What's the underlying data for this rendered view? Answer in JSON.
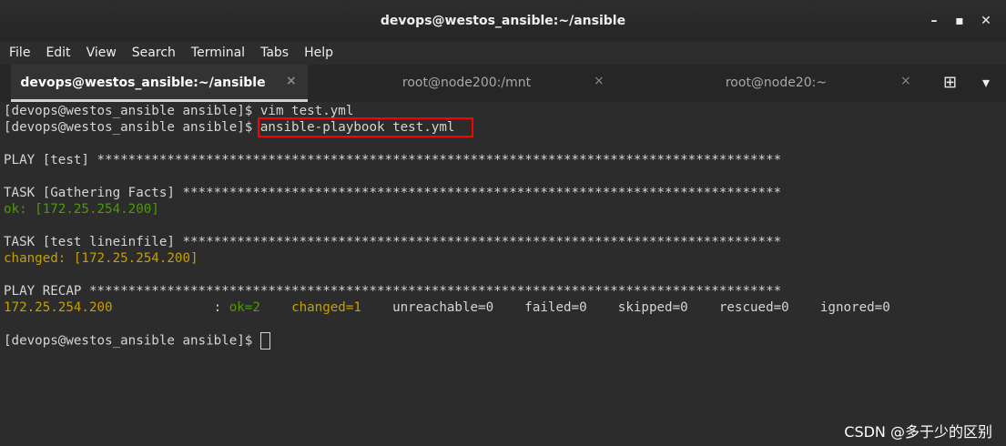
{
  "window": {
    "title": "devops@westos_ansible:~/ansible",
    "min": "–",
    "max": "▪",
    "close": "✕"
  },
  "menu": [
    "File",
    "Edit",
    "View",
    "Search",
    "Terminal",
    "Tabs",
    "Help"
  ],
  "tabs": [
    {
      "label": "devops@westos_ansible:~/ansible",
      "close": "×"
    },
    {
      "label": "root@node200:/mnt",
      "close": "×"
    },
    {
      "label": "root@node20:~",
      "close": "×"
    }
  ],
  "tabbar_icons": {
    "new_tab": "⊞",
    "dropdown": "▾"
  },
  "terminal": {
    "prompt": "[devops@westos_ansible ansible]$ ",
    "cmd1": "vim test.yml",
    "cmd2": "ansible-playbook test.yml",
    "play": "PLAY [test] ****************************************************************************************",
    "task1": "TASK [Gathering Facts] *****************************************************************************",
    "task1_result": "ok: [172.25.254.200]",
    "task2": "TASK [test lineinfile] *****************************************************************************",
    "task2_result": "changed: [172.25.254.200]",
    "recap": "PLAY RECAP *****************************************************************************************",
    "recap_host": "172.25.254.200",
    "recap_sep": "             : ",
    "recap_ok": "ok=2",
    "recap_gap1": "    ",
    "recap_changed": "changed=1",
    "recap_rest": "    unreachable=0    failed=0    skipped=0    rescued=0    ignored=0"
  },
  "watermark": "CSDN @多于少的区别",
  "colors": {
    "ok": "#4e9a06",
    "changed": "#c4a000",
    "highlight": "#ff0000"
  }
}
